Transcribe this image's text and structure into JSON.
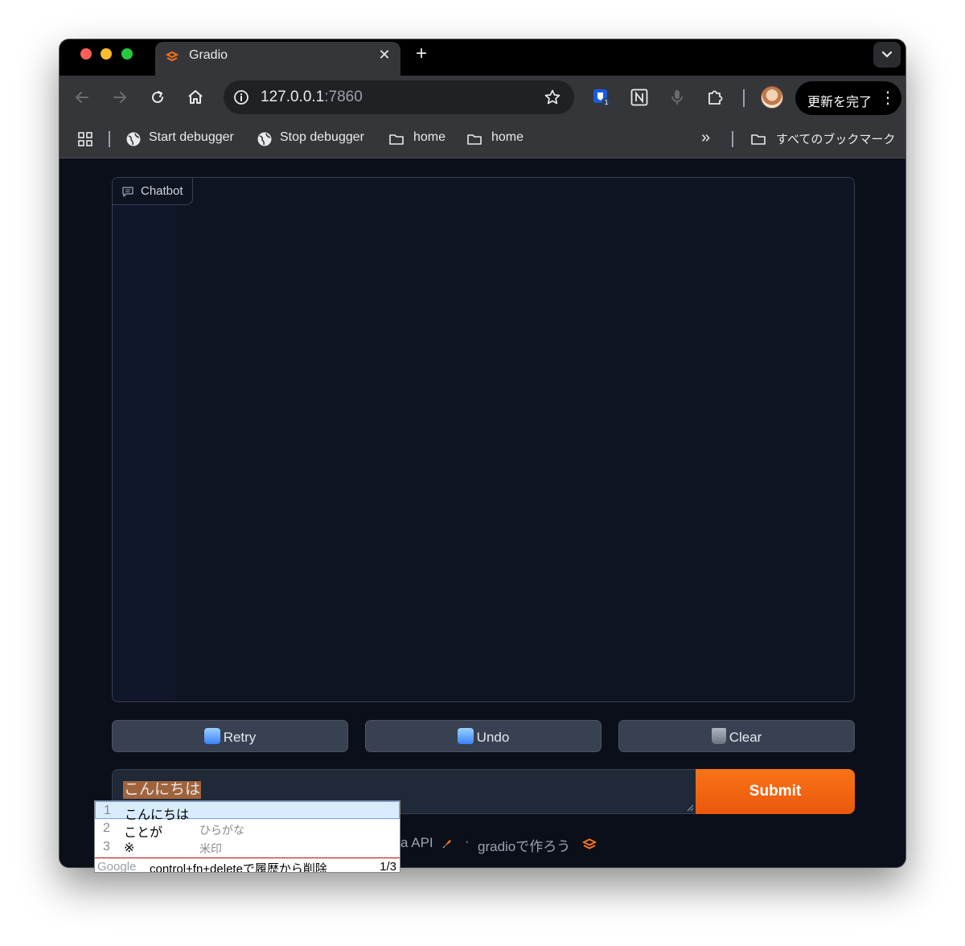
{
  "browser": {
    "tab": {
      "title": "Gradio",
      "close_glyph": "✕",
      "favicon": "gradio-logo-icon"
    },
    "new_tab_glyph": "+",
    "address": {
      "host": "127.0.0.1",
      "port": ":7860"
    },
    "update_button": {
      "label": "更新を完了",
      "more_glyph": "⋮"
    },
    "extensions": [
      "bitwarden-icon",
      "notion-icon",
      "microphone-icon",
      "puzzle-extensions-icon"
    ],
    "extension_badge": "1"
  },
  "bookmarks": {
    "items": [
      {
        "label": "Start debugger",
        "icon": "globe-icon"
      },
      {
        "label": "Stop debugger",
        "icon": "globe-icon"
      },
      {
        "label": "home",
        "icon": "folder-icon"
      },
      {
        "label": "home",
        "icon": "folder-icon"
      }
    ],
    "overflow_glyph": "»",
    "all_bookmarks": "すべてのブックマーク"
  },
  "chatbot": {
    "label": "Chatbot"
  },
  "buttons": {
    "retry": "Retry",
    "undo": "Undo",
    "clear": "Clear"
  },
  "input": {
    "composing_text": "こんにちは"
  },
  "submit": {
    "label": "Submit"
  },
  "footer": {
    "api_text": "a API",
    "separator": "·",
    "built_with": "gradioで作ろう"
  },
  "ime": {
    "candidates": [
      {
        "num": "1",
        "text": "こんにちは",
        "note": ""
      },
      {
        "num": "2",
        "text": "ことが",
        "note": "ひらがな"
      },
      {
        "num": "3",
        "text": "※",
        "note": "米印"
      }
    ],
    "provider": "Google",
    "hint": "control+fn+deleteで履歴から削除",
    "page": "1/3"
  },
  "colors": {
    "accent": "#f97316",
    "page_background": "#0b0f19",
    "panel_border": "#374151",
    "button_background": "#374151"
  }
}
